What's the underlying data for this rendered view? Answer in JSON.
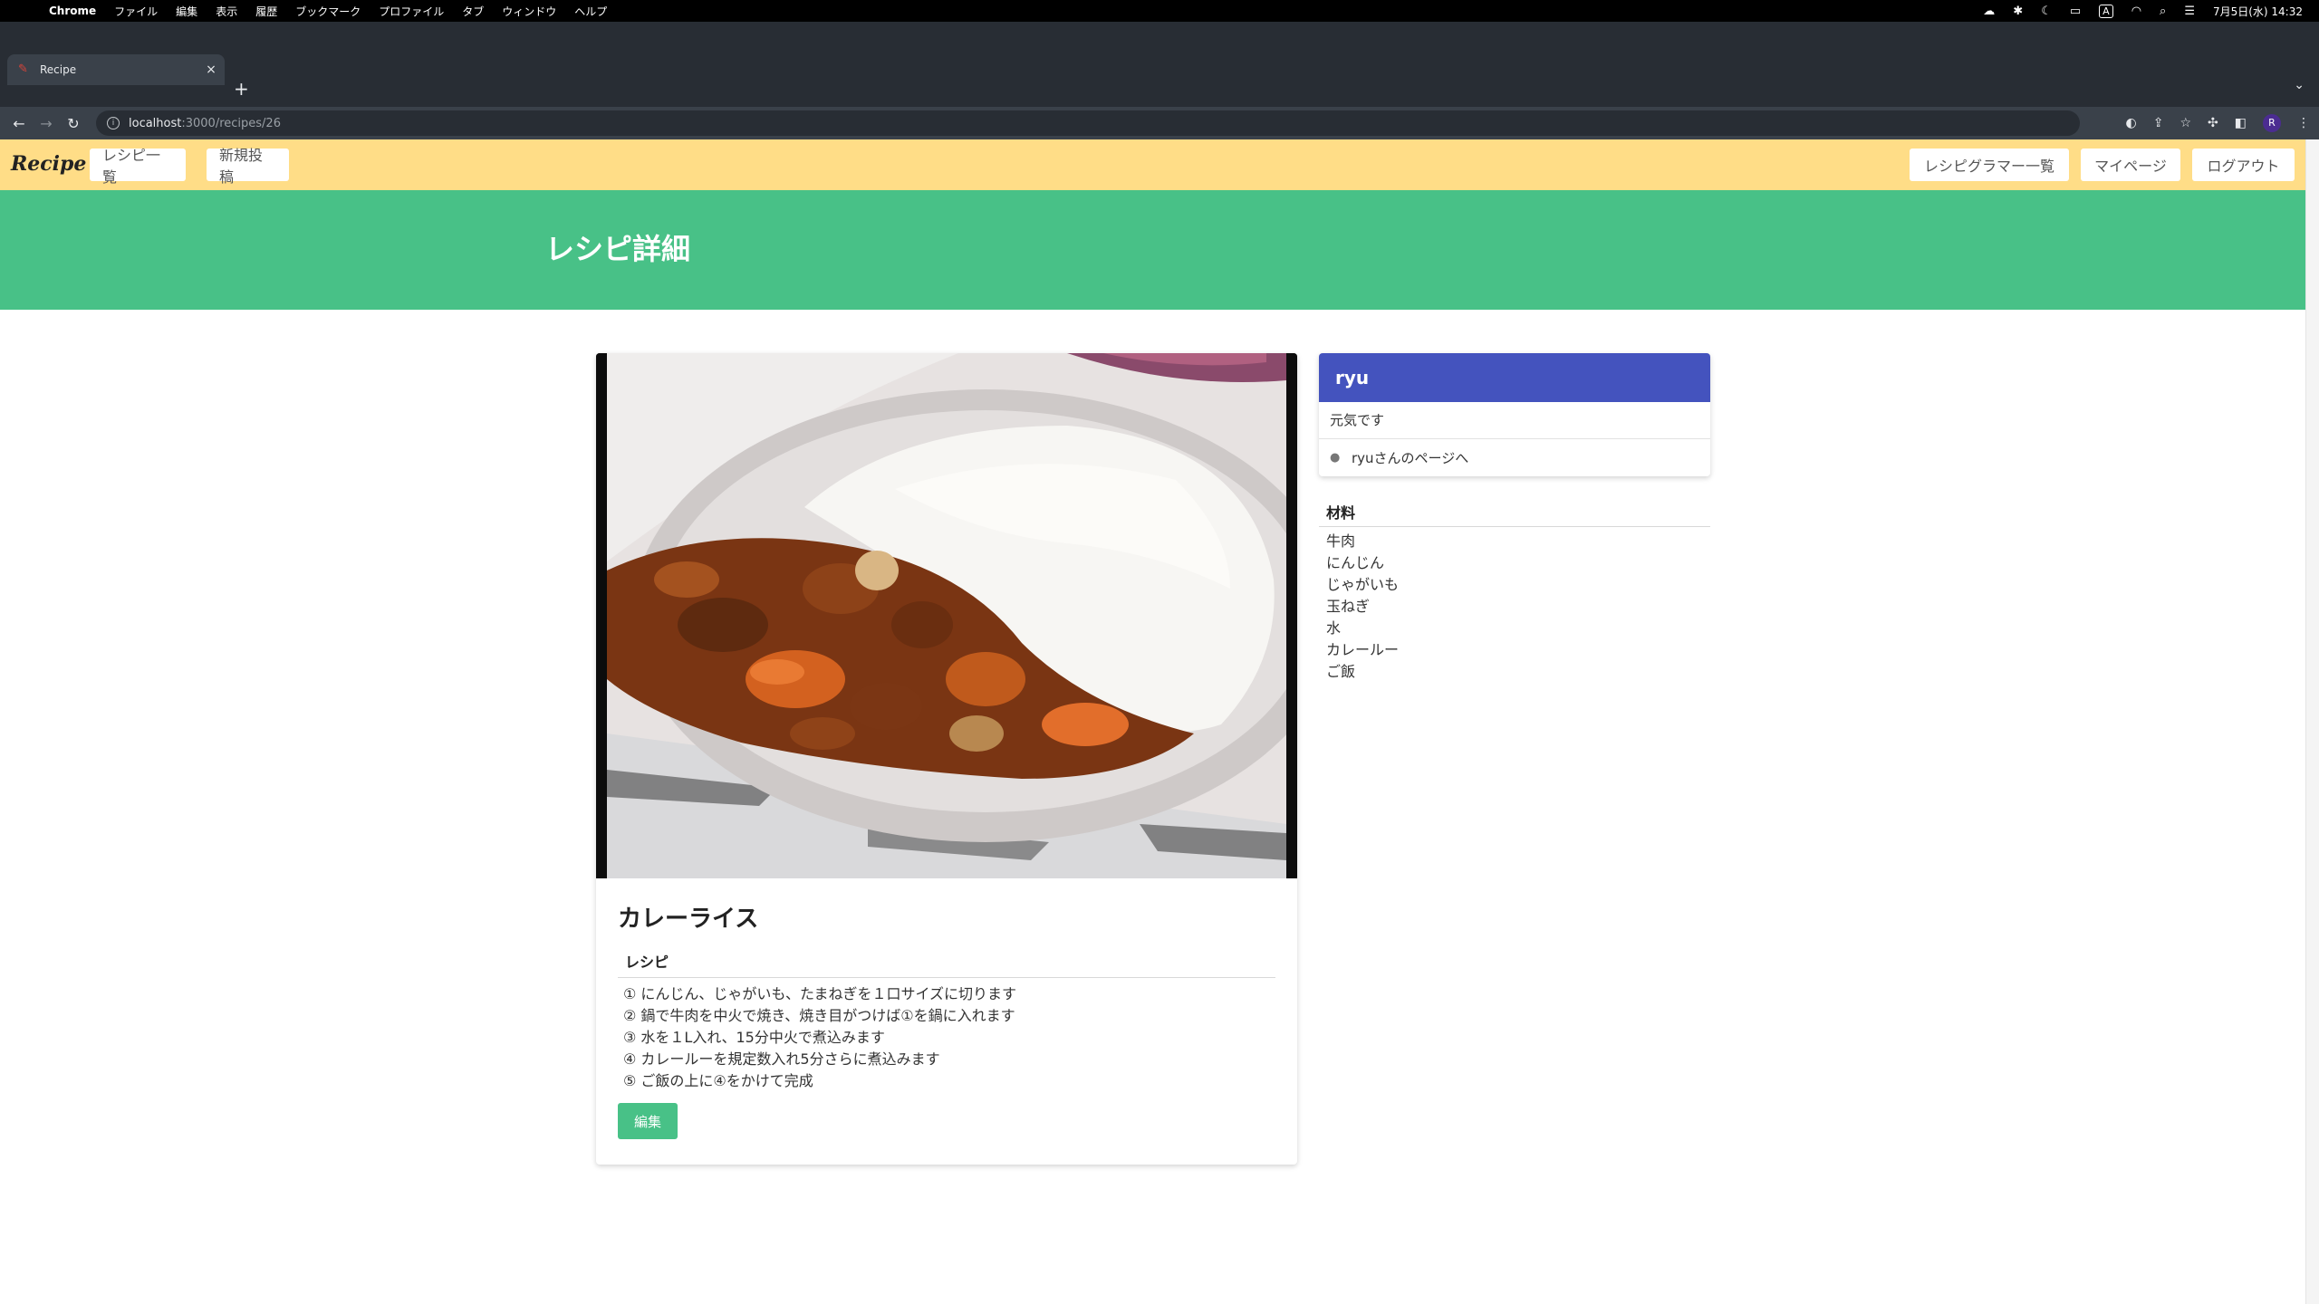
{
  "macos": {
    "app_name": "Chrome",
    "menus": [
      "ファイル",
      "編集",
      "表示",
      "履歴",
      "ブックマーク",
      "プロファイル",
      "タブ",
      "ウィンドウ",
      "ヘルプ"
    ],
    "clock": "7月5日(水) 14:32",
    "input_indicator": "A"
  },
  "browser": {
    "tab_title": "Recipe",
    "url_host": "localhost",
    "url_path": ":3000/recipes/26",
    "profile_initial": "R"
  },
  "site": {
    "brand": "Recipe",
    "nav": {
      "recipe_list": "レシピ一覧",
      "new_post": "新規投稿",
      "recipegrammer_list": "レシピグラマー一覧",
      "my_page": "マイページ",
      "logout": "ログアウト"
    },
    "hero_title": "レシピ詳細"
  },
  "recipe": {
    "title": "カレーライス",
    "section_label": "レシピ",
    "steps": [
      "① にんじん、じゃがいも、たまねぎを１口サイズに切ります",
      "② 鍋で牛肉を中火で焼き、焼き目がつけば①を鍋に入れます",
      "③ 水を１L入れ、15分中火で煮込みます",
      "④ カレールーを規定数入れ5分さらに煮込みます",
      "⑤ ご飯の上に④をかけて完成"
    ],
    "edit_button": "編集"
  },
  "user": {
    "name": "ryu",
    "bio": "元気です",
    "page_link": "ryuさんのページへ"
  },
  "ingredients": {
    "label": "材料",
    "items": [
      "牛肉",
      "にんじん",
      "じゃがいも",
      "玉ねぎ",
      "水",
      "カレールー",
      "ご飯"
    ]
  }
}
